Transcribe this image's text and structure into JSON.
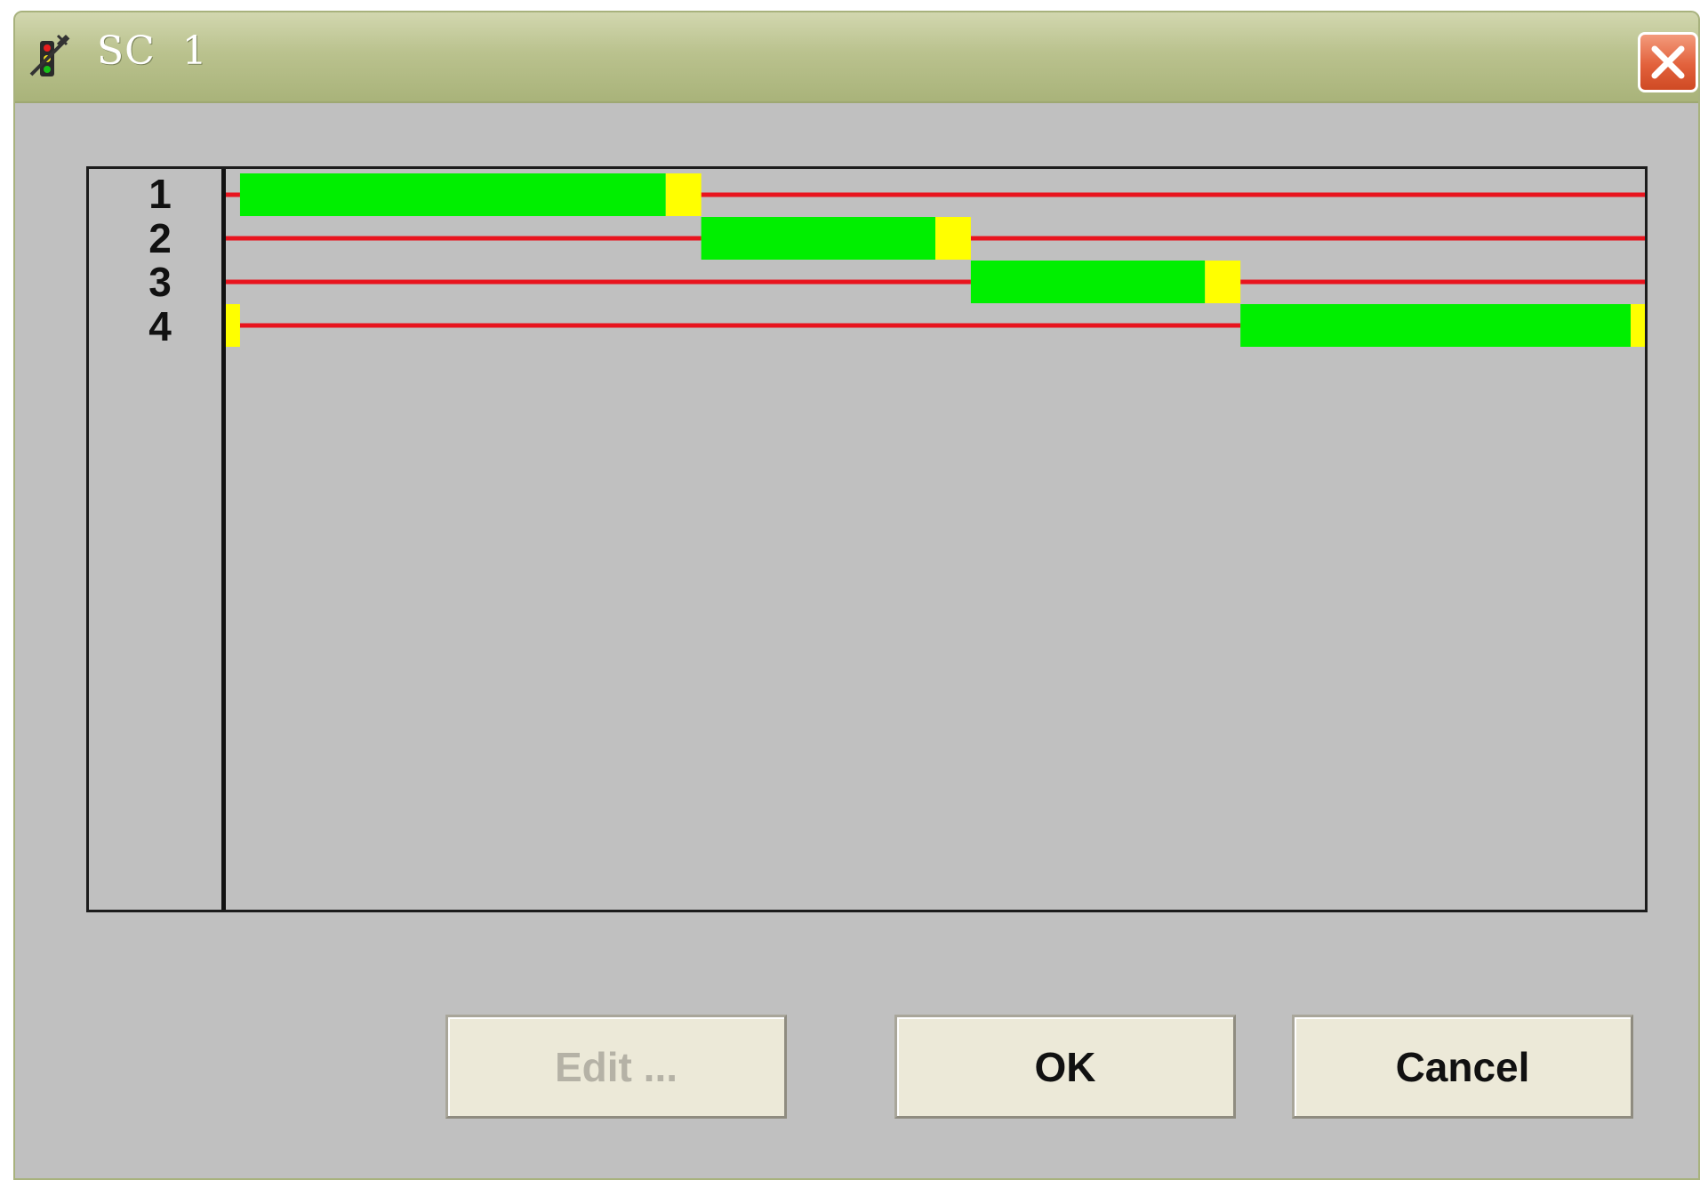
{
  "window": {
    "title": "SC  1"
  },
  "rows": [
    {
      "label": "1"
    },
    {
      "label": "2"
    },
    {
      "label": "3"
    },
    {
      "label": "4"
    }
  ],
  "buttons": {
    "edit_label": "Edit ...",
    "ok_label": "OK",
    "cancel_label": "Cancel"
  },
  "colors": {
    "green_interval": "#00ef00",
    "yellow_interval": "#ffff00",
    "red_line": "#e8141e",
    "close_button": "#e2613c"
  },
  "chart_data": {
    "type": "timeline",
    "cycle_fraction_axis": [
      0,
      1
    ],
    "signal_groups": [
      {
        "label": "1",
        "green": [
          0.01,
          0.31
        ],
        "yellow": [
          0.31,
          0.335
        ],
        "red": [
          [
            0,
            0.01
          ],
          [
            0.335,
            1
          ]
        ]
      },
      {
        "label": "2",
        "green": [
          0.335,
          0.5
        ],
        "yellow": [
          0.5,
          0.525
        ],
        "red": [
          [
            0,
            0.335
          ],
          [
            0.525,
            1
          ]
        ]
      },
      {
        "label": "3",
        "green": [
          0.525,
          0.69
        ],
        "yellow": [
          0.69,
          0.715
        ],
        "red": [
          [
            0,
            0.525
          ],
          [
            0.715,
            1
          ]
        ]
      },
      {
        "label": "4",
        "green": [
          0.715,
          0.99
        ],
        "yellow": [
          [
            0,
            0.01
          ],
          [
            0.99,
            1
          ]
        ],
        "red": [
          [
            0.01,
            0.715
          ]
        ]
      }
    ]
  }
}
